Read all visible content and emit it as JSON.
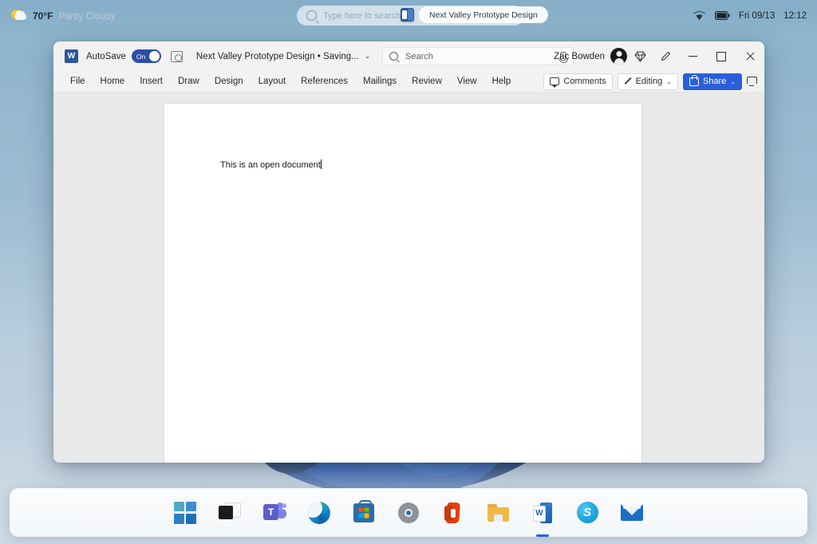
{
  "desktop": {
    "wallpaper_name": "windows-bloom-wallpaper"
  },
  "topbar": {
    "weather": {
      "icon": "partly-cloudy-icon",
      "temperature": "70°F",
      "condition": "Partly Cloudy"
    },
    "search": {
      "icon": "search-icon",
      "placeholder": "Type here to search"
    },
    "app_chip": {
      "icon": "word-icon",
      "label": "Next Valley Prototype Design"
    },
    "tray": {
      "wifi_icon": "wifi-icon",
      "battery_icon": "battery-icon",
      "date": "Fri 09/13",
      "time": "12:12"
    }
  },
  "word": {
    "titlebar": {
      "app_icon": "word-icon",
      "autosave_label": "AutoSave",
      "autosave_state": "On",
      "save_status_icon": "save-status-icon",
      "document_title": "Next Valley Prototype Design • Saving...",
      "title_chevron": "⌄",
      "search_icon": "search-icon",
      "search_placeholder": "Search",
      "mic_icon": "microphone-icon",
      "user_name": "Zac Bowden",
      "avatar": "user-avatar",
      "diamond_icon": "diamond-icon",
      "pen_icon": "pen-icon",
      "minimize": "minimize-icon",
      "maximize": "maximize-icon",
      "close": "close-icon"
    },
    "ribbon": {
      "tabs": [
        {
          "label": "File"
        },
        {
          "label": "Home"
        },
        {
          "label": "Insert"
        },
        {
          "label": "Draw"
        },
        {
          "label": "Design"
        },
        {
          "label": "Layout"
        },
        {
          "label": "References"
        },
        {
          "label": "Mailings"
        },
        {
          "label": "Review"
        },
        {
          "label": "View"
        },
        {
          "label": "Help"
        }
      ],
      "comments_label": "Comments",
      "editing_label": "Editing",
      "editing_chevron": "⌄",
      "share_label": "Share",
      "share_chevron": "⌄",
      "ribbon_display_icon": "ribbon-display-options-icon",
      "share_color": "#2b5fd9"
    },
    "document": {
      "text": "This is an open document"
    }
  },
  "taskbar": {
    "items": [
      {
        "name": "start-button",
        "label": "Start"
      },
      {
        "name": "task-view-button",
        "label": "Task View"
      },
      {
        "name": "teams-button",
        "label": "Microsoft Teams"
      },
      {
        "name": "edge-button",
        "label": "Microsoft Edge"
      },
      {
        "name": "store-button",
        "label": "Microsoft Store"
      },
      {
        "name": "settings-button",
        "label": "Settings"
      },
      {
        "name": "office-button",
        "label": "Office"
      },
      {
        "name": "file-explorer-button",
        "label": "File Explorer"
      },
      {
        "name": "word-button",
        "label": "Word"
      },
      {
        "name": "skype-button",
        "label": "Skype"
      },
      {
        "name": "mail-button",
        "label": "Mail"
      }
    ]
  }
}
